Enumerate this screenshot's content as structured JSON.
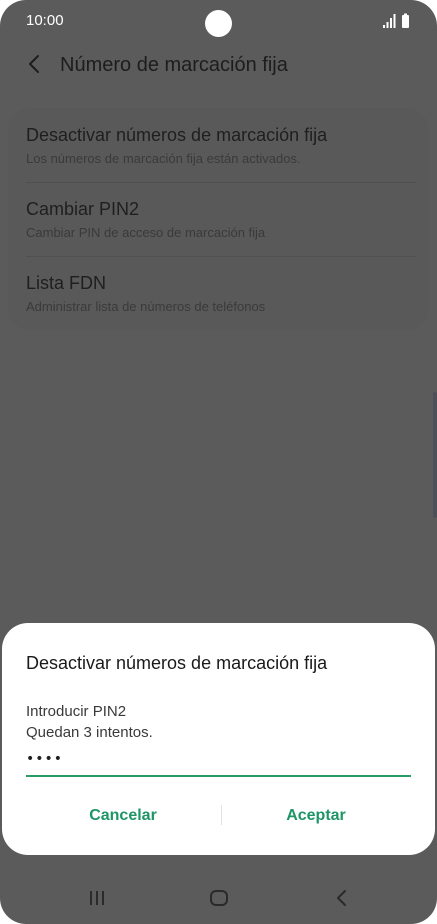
{
  "status_bar": {
    "time": "10:00",
    "icons": [
      "signal-icon",
      "battery-icon"
    ]
  },
  "app_bar": {
    "back_icon": "chevron-left-icon",
    "title": "Número de marcación fija"
  },
  "settings": {
    "items": [
      {
        "title": "Desactivar números de marcación fija",
        "subtitle": "Los números de marcación fija están activados."
      },
      {
        "title": "Cambiar PIN2",
        "subtitle": "Cambiar PIN de acceso de marcación fija"
      },
      {
        "title": "Lista FDN",
        "subtitle": "Administrar lista de números de teléfonos"
      }
    ]
  },
  "dialog": {
    "title": "Desactivar números de marcación fija",
    "message_line1": "Introducir PIN2",
    "message_line2": "Quedan 3 intentos.",
    "pin_value": "••••",
    "cancel_label": "Cancelar",
    "accept_label": "Aceptar",
    "accent_color": "#1e9566"
  },
  "nav_bar": {
    "icons": [
      "recents-icon",
      "home-icon",
      "back-icon"
    ]
  },
  "colors": {
    "scrim": "#5b5b5b",
    "dialog_bg": "#ffffff",
    "accent": "#1e9566"
  }
}
